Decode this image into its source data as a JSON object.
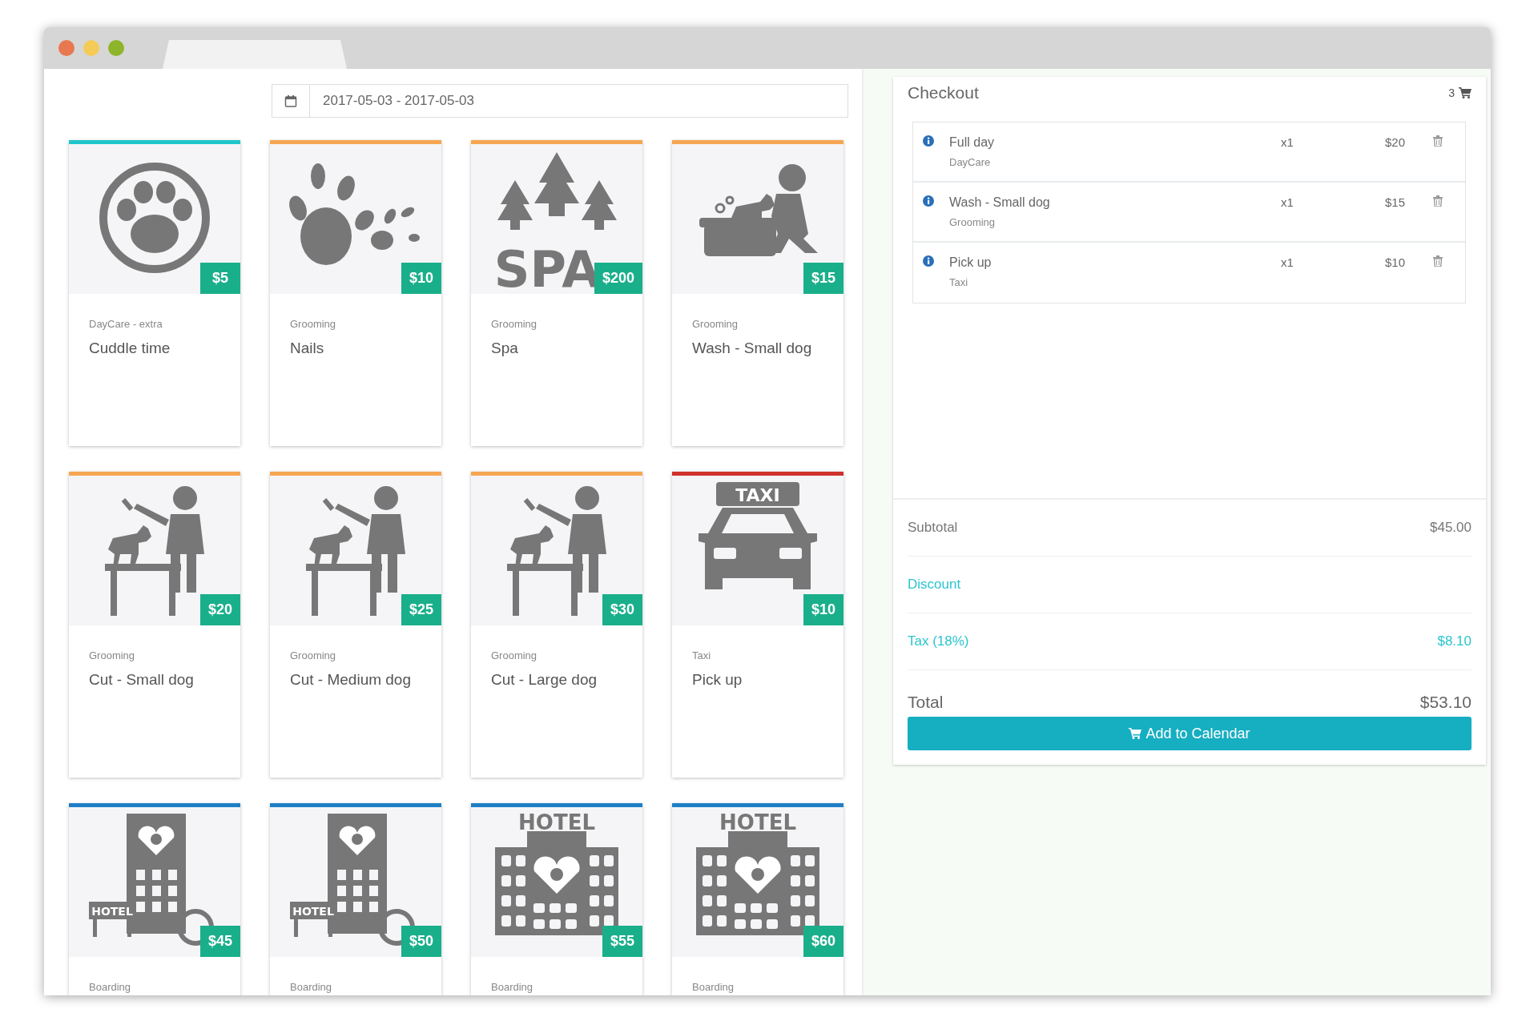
{
  "date_range": {
    "value": "2017-05-03 - 2017-05-03"
  },
  "services": [
    {
      "category": "DayCare - extra",
      "title": "Cuddle time",
      "price": "$5",
      "color": "#1fc6cb",
      "image": {
        "kind": "paw-circle"
      }
    },
    {
      "category": "Grooming",
      "title": "Nails",
      "price": "$10",
      "color": "#f6a651",
      "image": {
        "kind": "paw-prints"
      }
    },
    {
      "category": "Grooming",
      "title": "Spa",
      "price": "$200",
      "color": "#f6a651",
      "image": {
        "kind": "spa",
        "label": "SPA"
      }
    },
    {
      "category": "Grooming",
      "title": "Wash - Small dog",
      "price": "$15",
      "color": "#f6a651",
      "image": {
        "kind": "wash"
      }
    },
    {
      "category": "Grooming",
      "title": "Cut - Small dog",
      "price": "$20",
      "color": "#f6a651",
      "image": {
        "kind": "groomer"
      }
    },
    {
      "category": "Grooming",
      "title": "Cut - Medium dog",
      "price": "$25",
      "color": "#f6a651",
      "image": {
        "kind": "groomer"
      }
    },
    {
      "category": "Grooming",
      "title": "Cut - Large dog",
      "price": "$30",
      "color": "#f6a651",
      "image": {
        "kind": "groomer"
      }
    },
    {
      "category": "Taxi",
      "title": "Pick up",
      "price": "$10",
      "color": "#d0312d",
      "image": {
        "kind": "taxi",
        "label": "TAXI"
      }
    },
    {
      "category": "Boarding",
      "price": "$45",
      "color": "#1f7fc6",
      "image": {
        "kind": "hotel-tower",
        "label": "HOTEL"
      }
    },
    {
      "category": "Boarding",
      "price": "$50",
      "color": "#1f7fc6",
      "image": {
        "kind": "hotel-tower",
        "label": "HOTEL"
      }
    },
    {
      "category": "Boarding",
      "price": "$55",
      "color": "#1f7fc6",
      "image": {
        "kind": "hotel-building",
        "label": "HOTEL"
      }
    },
    {
      "category": "Boarding",
      "price": "$60",
      "color": "#1f7fc6",
      "image": {
        "kind": "hotel-building",
        "label": "HOTEL"
      }
    }
  ],
  "checkout": {
    "title": "Checkout",
    "cart_count": "3",
    "items": [
      {
        "name": "Full day",
        "category": "DayCare",
        "quantity": "x1",
        "price": "$20"
      },
      {
        "name": "Wash - Small dog",
        "category": "Grooming",
        "quantity": "x1",
        "price": "$15"
      },
      {
        "name": "Pick up",
        "category": "Taxi",
        "quantity": "x1",
        "price": "$10"
      }
    ],
    "summary": [
      {
        "kind": "plain",
        "label": "Subtotal",
        "value": "$45.00"
      },
      {
        "kind": "link",
        "label": "Discount"
      },
      {
        "kind": "link",
        "label": "Tax (18%)",
        "value": "$8.10"
      },
      {
        "kind": "total",
        "label": "Total",
        "value": "$53.10"
      }
    ],
    "button": "Add to Calendar"
  }
}
